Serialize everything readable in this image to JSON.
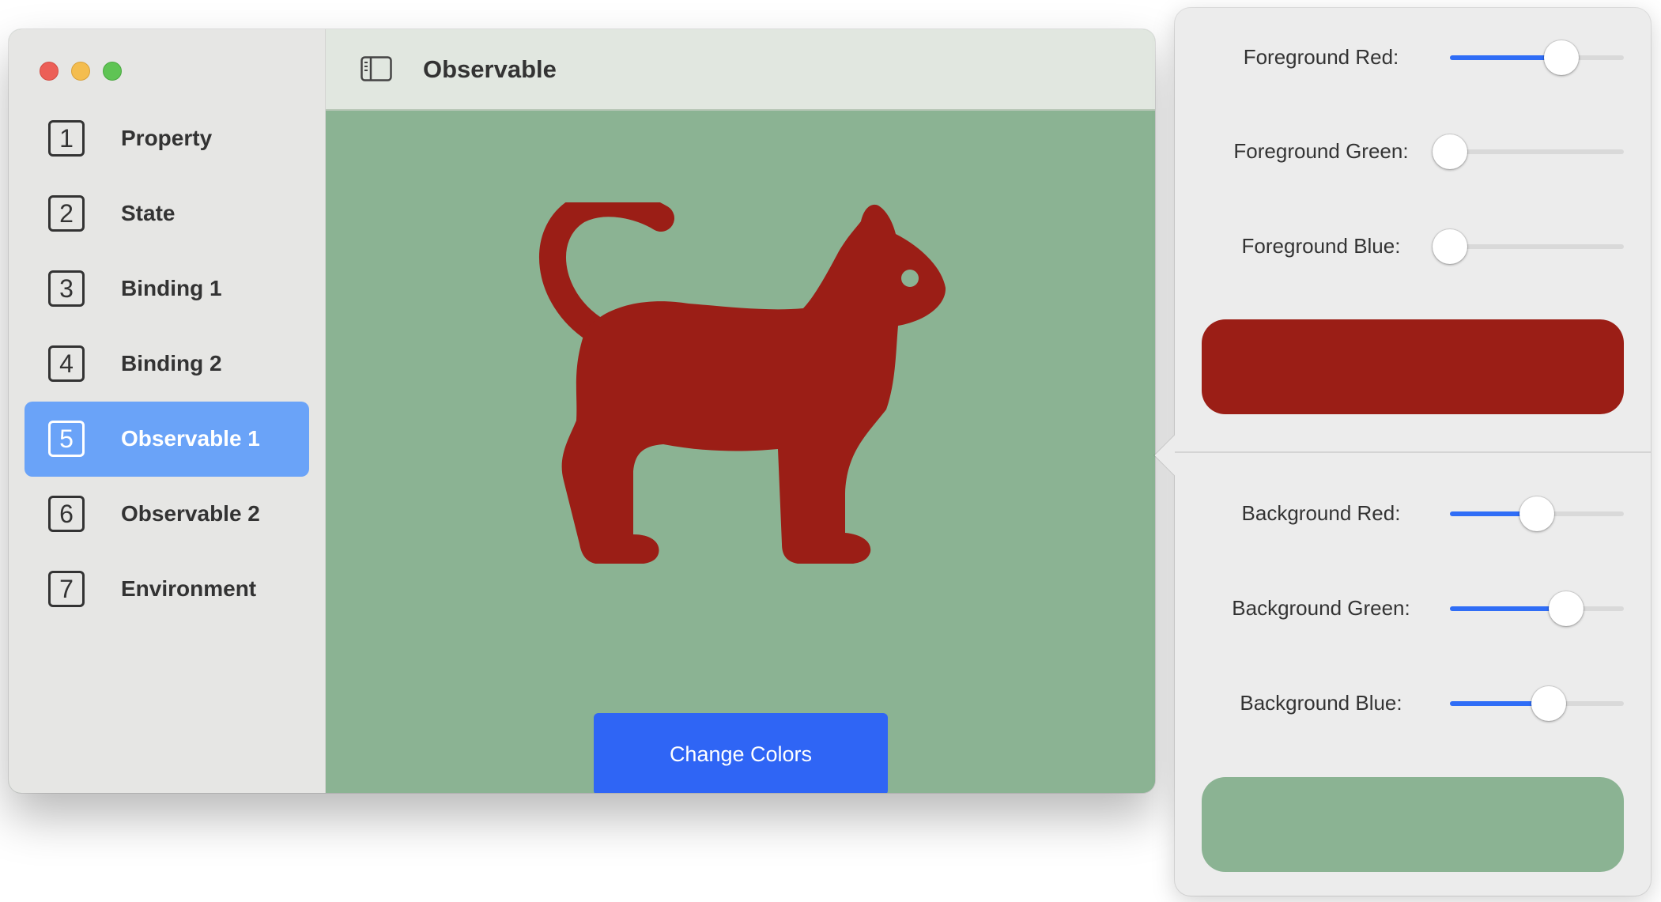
{
  "window": {
    "title": "Observable"
  },
  "sidebar": {
    "items": [
      {
        "number": "1",
        "label": "Property"
      },
      {
        "number": "2",
        "label": "State"
      },
      {
        "number": "3",
        "label": "Binding 1"
      },
      {
        "number": "4",
        "label": "Binding 2"
      },
      {
        "number": "5",
        "label": "Observable 1"
      },
      {
        "number": "6",
        "label": "Observable 2"
      },
      {
        "number": "7",
        "label": "Environment"
      }
    ],
    "selected_index": 4
  },
  "content": {
    "image_icon": "cat-icon",
    "foreground_color": "#9b1e16",
    "background_color": "#8bb393",
    "button_label": "Change Colors"
  },
  "popover": {
    "foreground": {
      "red_label": "Foreground Red:",
      "red_value": 0.64,
      "green_label": "Foreground Green:",
      "green_value": 0.0,
      "blue_label": "Foreground Blue:",
      "blue_value": 0.0,
      "swatch_color": "#9b1e16"
    },
    "background": {
      "red_label": "Background Red:",
      "red_value": 0.5,
      "green_label": "Background Green:",
      "green_value": 0.67,
      "blue_label": "Background Blue:",
      "blue_value": 0.57,
      "swatch_color": "#8bb393"
    }
  },
  "colors": {
    "accent": "#2f6df6",
    "button": "#2f65f5",
    "selection": "#6aa3f8"
  }
}
